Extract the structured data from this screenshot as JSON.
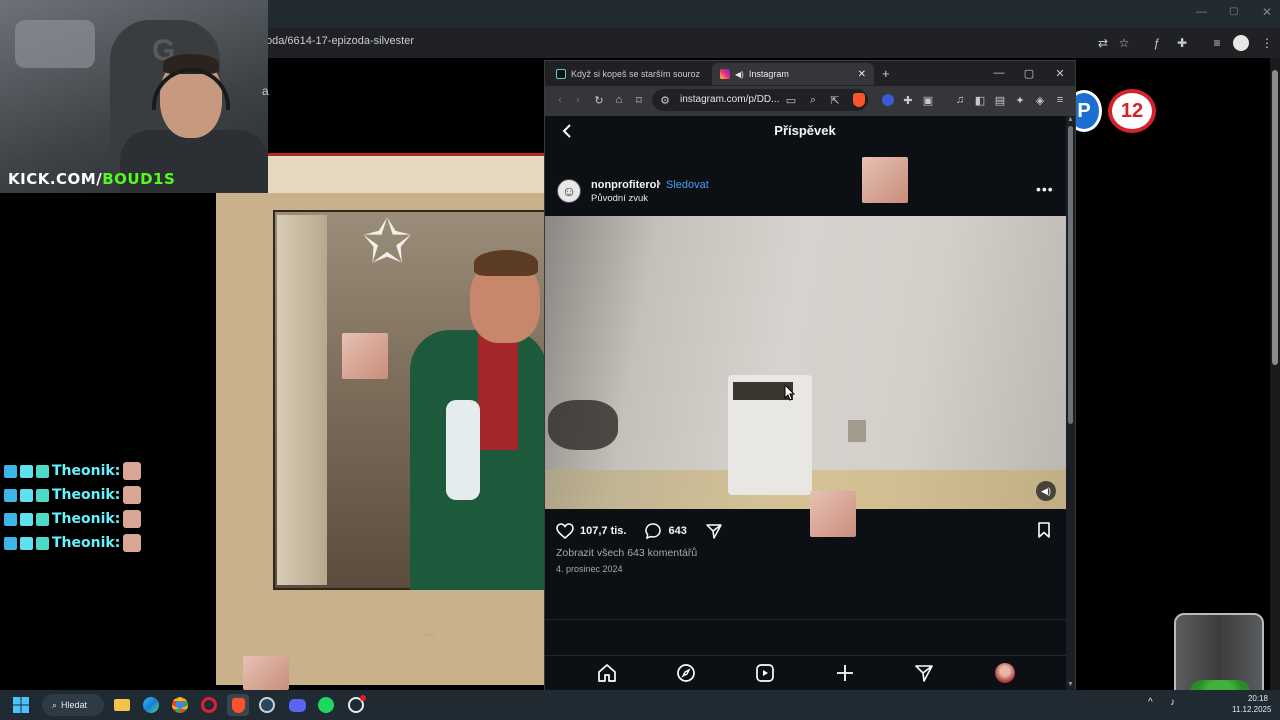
{
  "back_browser": {
    "url": "oda/6614-17-epizoda-silvester",
    "badge_p": "P",
    "badge_rating": "12"
  },
  "webcam": {
    "kick_prefix": "KICK.COM/",
    "kick_channel": "BOUD1S",
    "side_text": "a"
  },
  "chat": {
    "lines": [
      {
        "name": "Theonik:"
      },
      {
        "name": "Theonik:"
      },
      {
        "name": "Theonik:"
      },
      {
        "name": "Theonik:"
      }
    ]
  },
  "front_browser": {
    "tabs": [
      {
        "label": "Když si kopeš se starším sourozencem",
        "icon": "tiktok-icon"
      },
      {
        "label": "Instagram",
        "icon": "instagram-icon"
      }
    ],
    "url": "instagram.com/p/DD..."
  },
  "instagram": {
    "header_title": "Příspěvek",
    "username": "nonprofiterol",
    "separator": "•",
    "follow_label": "Sledovat",
    "audio_label": "Původní zvuk",
    "likes": "107,7 tis.",
    "comments_count": "643",
    "view_comments": "Zobrazit všech 643 komentářů",
    "date": "4. prosinec 2024",
    "nav_icons": [
      "home-icon",
      "explore-icon",
      "reels-icon",
      "create-icon",
      "direct-icon",
      "profile-avatar"
    ]
  },
  "taskbar": {
    "search_label": "Hledat",
    "time": "20:18",
    "date": "11.12.2025",
    "apps": [
      "windows-start-icon",
      "file-explorer-icon",
      "edge-icon",
      "chrome-icon",
      "opera-icon",
      "brave-icon",
      "steam-icon",
      "discord-icon",
      "spotify-icon",
      "obs-icon"
    ]
  },
  "colors": {
    "kick_green": "#53fc18",
    "chat_name": "#65f2ff",
    "ig_follow": "#4a9ef0",
    "ig_bg": "#0c1014"
  }
}
